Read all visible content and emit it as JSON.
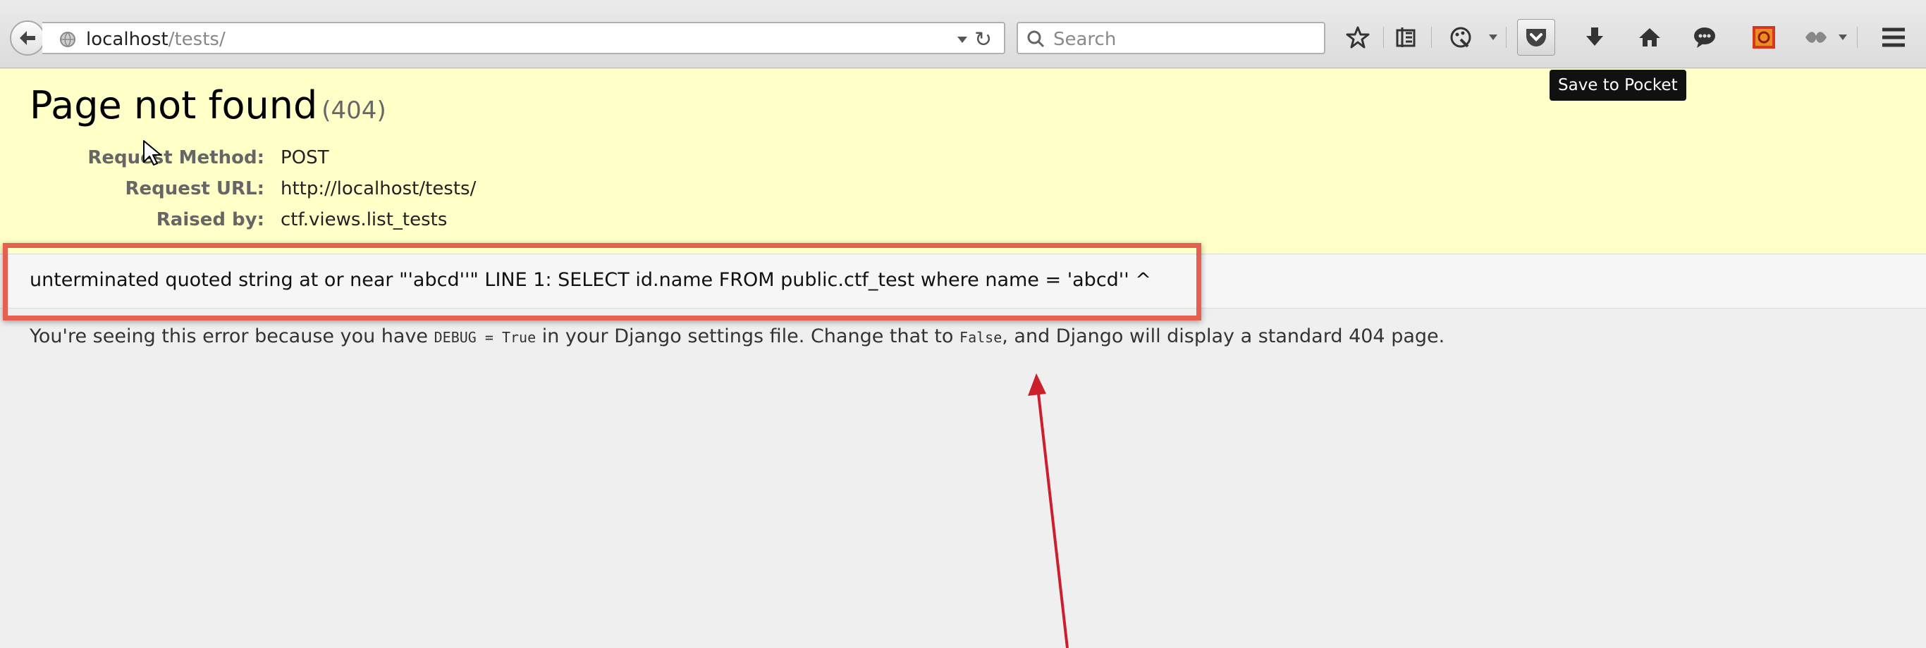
{
  "browser": {
    "url_host": "localhost",
    "url_path": "/tests/",
    "search_placeholder": "Search",
    "tooltip": "Save to Pocket"
  },
  "page": {
    "title": "Page not found",
    "status_code": "(404)",
    "meta": [
      {
        "label": "Request Method:",
        "value": "POST"
      },
      {
        "label": "Request URL:",
        "value": "http://localhost/tests/"
      },
      {
        "label": "Raised by:",
        "value": "ctf.views.list_tests"
      }
    ],
    "error_message": "unterminated quoted string at or near \"'abcd''\" LINE 1: SELECT id.name FROM public.ctf_test where name = 'abcd'' ^",
    "explanation": {
      "part1": "You're seeing this error because you have",
      "code1": "DEBUG = True",
      "part2": "in your Django settings file. Change that to",
      "code2": "False",
      "part3": ", and Django will display a standard 404 page."
    }
  },
  "colors": {
    "summary_bg": "#ffffc8",
    "highlight_border": "#e6604f",
    "arrow": "#cc1f2e"
  }
}
